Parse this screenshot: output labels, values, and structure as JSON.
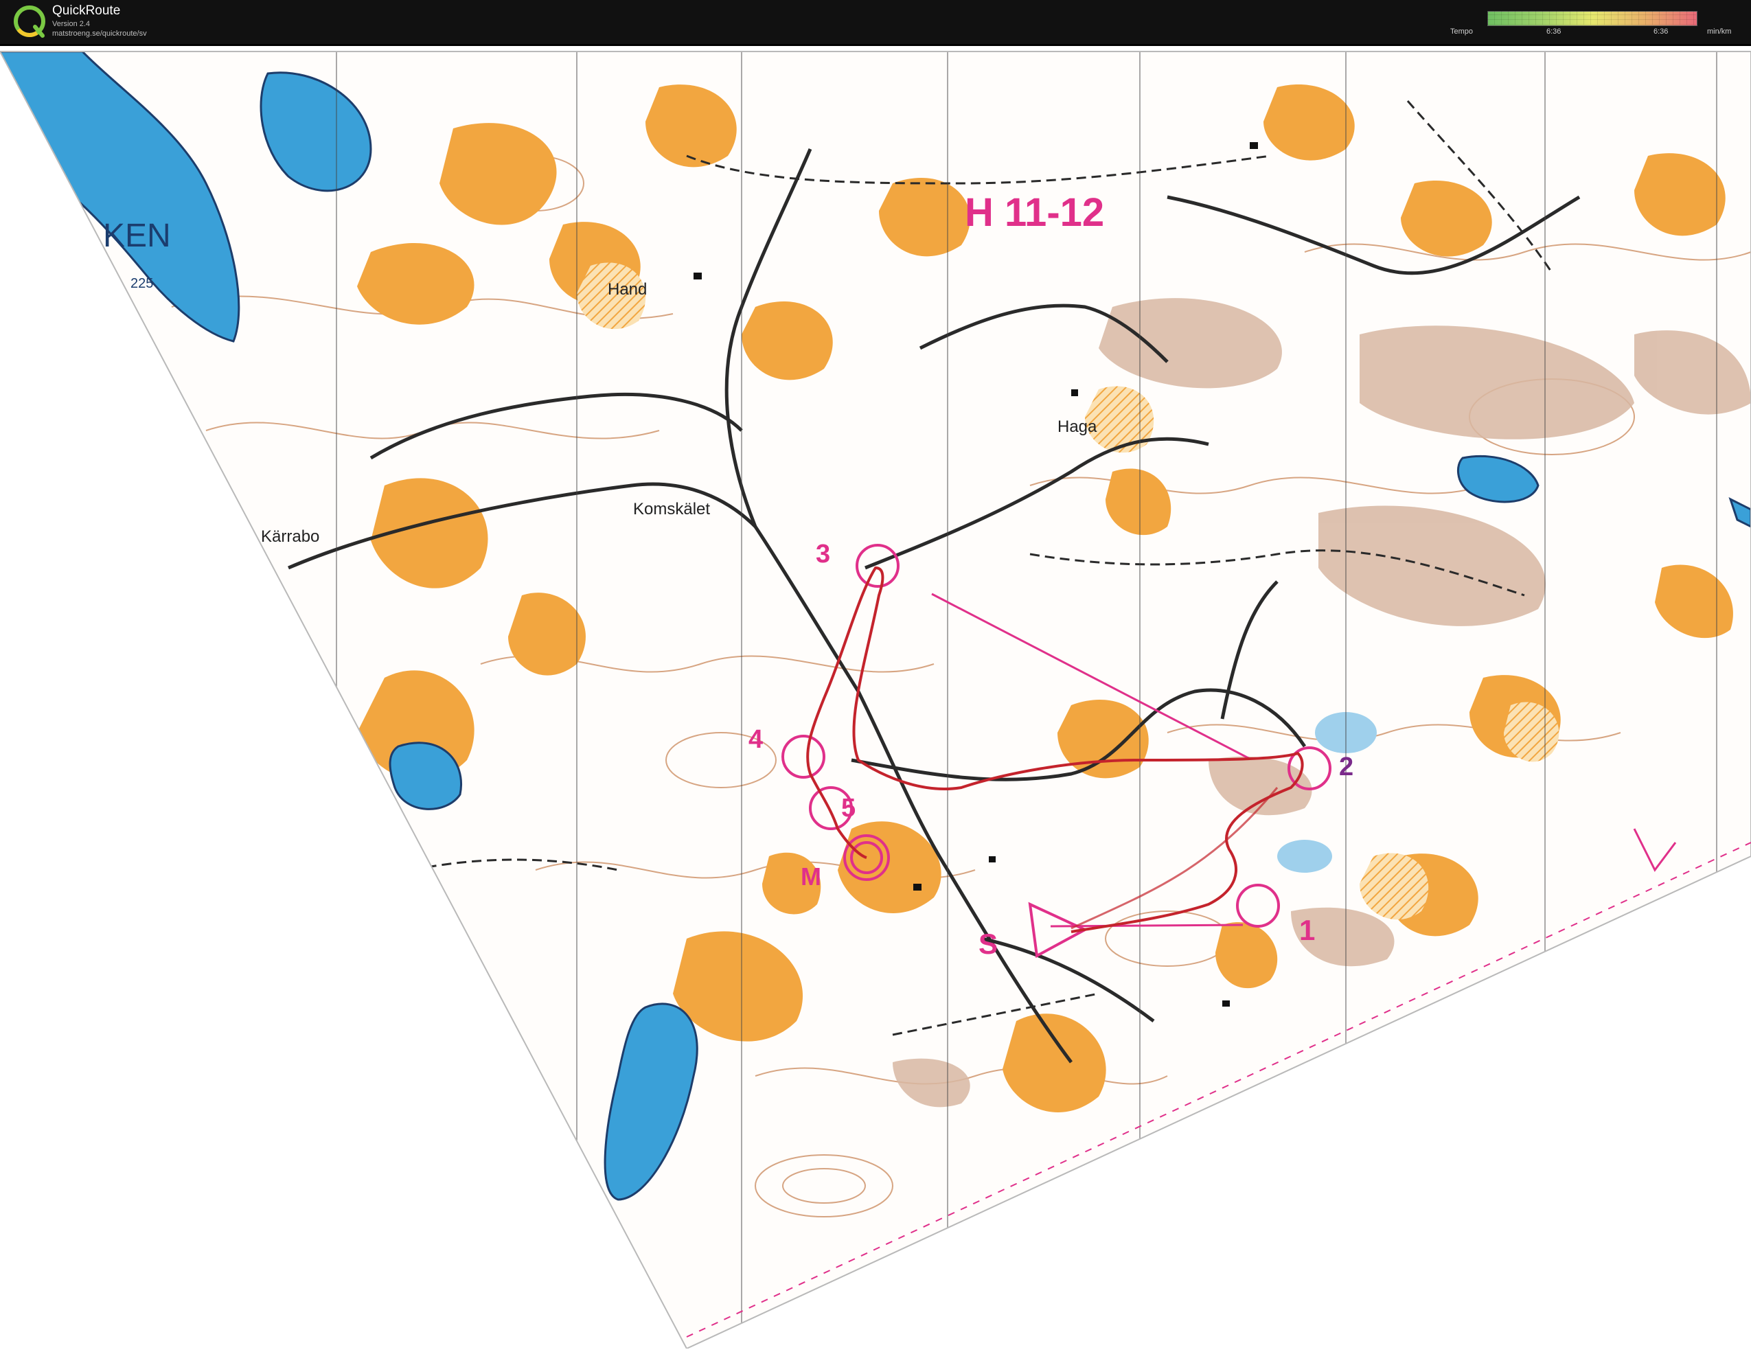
{
  "app": {
    "title": "QuickRoute",
    "version": "Version 2.4",
    "url": "matstroeng.se/quickroute/sv"
  },
  "tempo": {
    "label": "Tempo",
    "tick_left": "6:36",
    "tick_right": "6:36",
    "unit": "min/km"
  },
  "map": {
    "class_label": "H 11-12",
    "places": [
      "Hand",
      "Haga",
      "Komskälet",
      "Kärrabo"
    ],
    "lake_fragment": "KEN",
    "elevation": "225",
    "controls": {
      "start": "S",
      "c1": "1",
      "c2": "2",
      "c3": "3",
      "c4": "4",
      "c5": "5",
      "finish": "M"
    },
    "colors": {
      "forest_open": "#f2a640",
      "lake": "#3aa0d8",
      "course": "#e0308a",
      "route": "#c4232c",
      "road": "#2a2a2a",
      "contour": "#c9875a",
      "marsh": "#d8b7a2"
    }
  }
}
